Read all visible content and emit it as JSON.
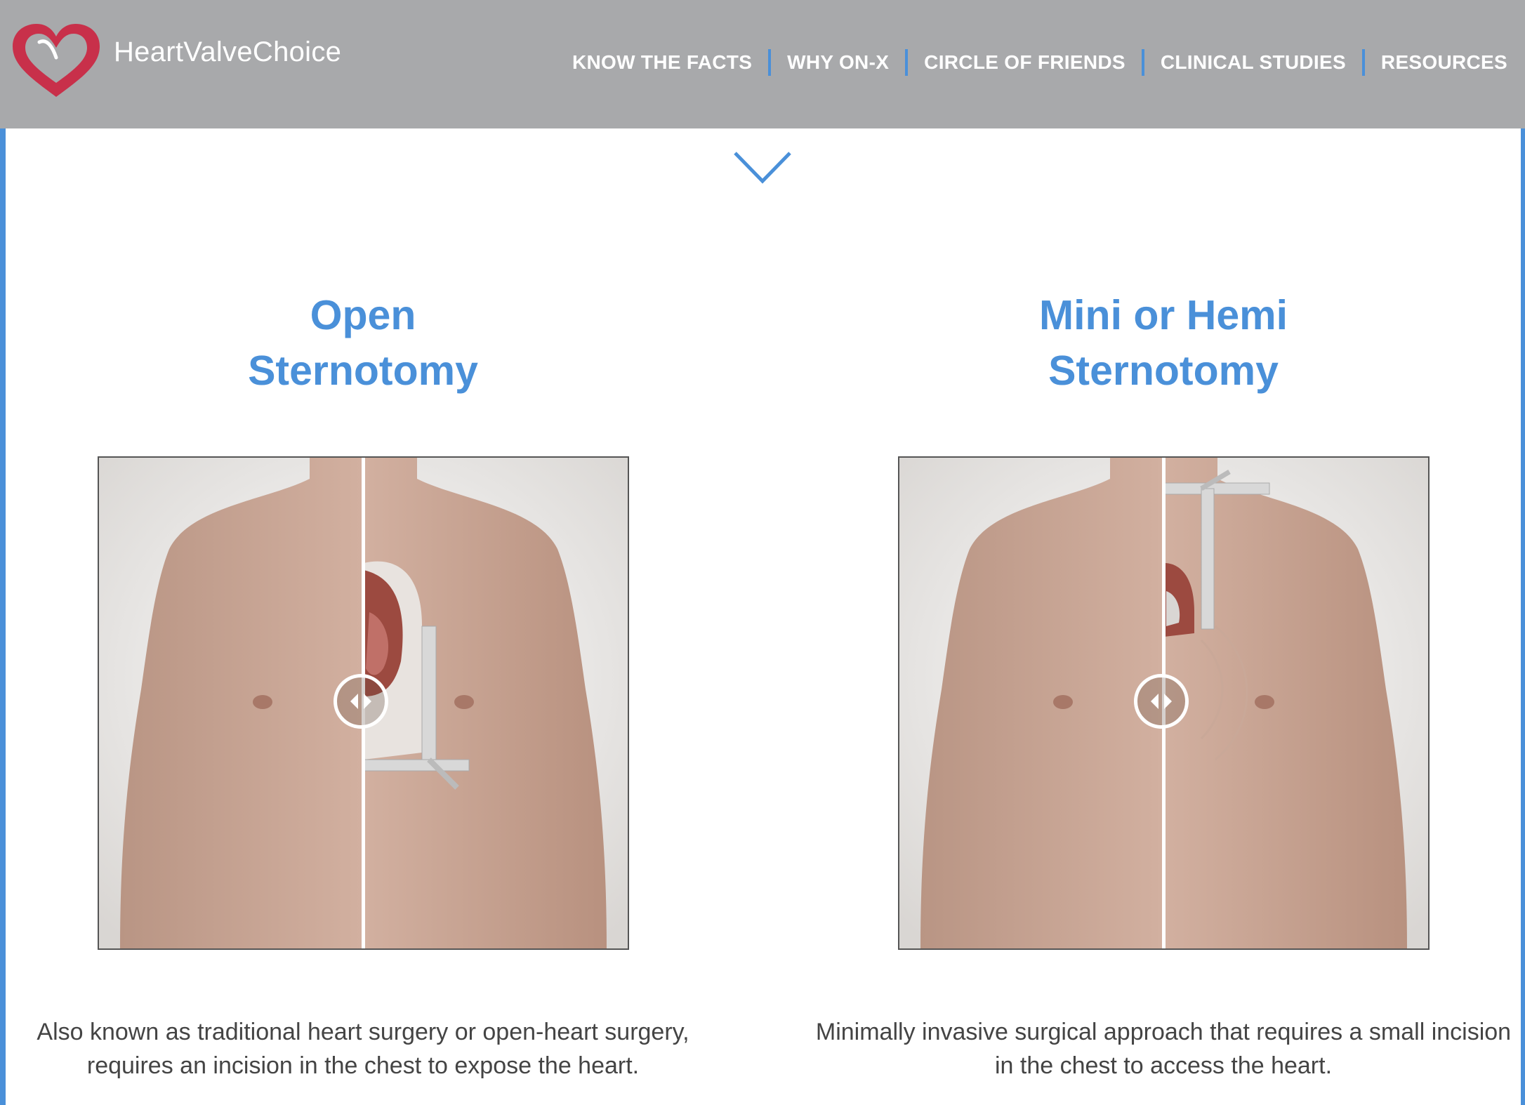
{
  "header": {
    "brand": "HeartValveChoice",
    "nav": [
      {
        "label": "KNOW THE FACTS"
      },
      {
        "label": "WHY ON-X"
      },
      {
        "label": "CIRCLE OF FRIENDS"
      },
      {
        "label": "CLINICAL STUDIES"
      },
      {
        "label": "RESOURCES"
      }
    ]
  },
  "colors": {
    "header_bg": "#a8a9ab",
    "accent_blue": "#4a90d9",
    "logo_red": "#c8304a",
    "body_text": "#444444"
  },
  "icons": [
    "heart-logo-icon",
    "chevron-down-icon",
    "slider-handle-icon"
  ],
  "sections": [
    {
      "title_line1": "Open",
      "title_line2": "Sternotomy",
      "description": "Also known as traditional heart surgery or open-heart surgery, requires an incision in the chest to expose the heart.",
      "slider_position": 0.5
    },
    {
      "title_line1": "Mini or Hemi",
      "title_line2": "Sternotomy",
      "description": "Minimally invasive surgical approach that requires a small incision in the chest to access the heart.",
      "slider_position": 0.5
    }
  ]
}
